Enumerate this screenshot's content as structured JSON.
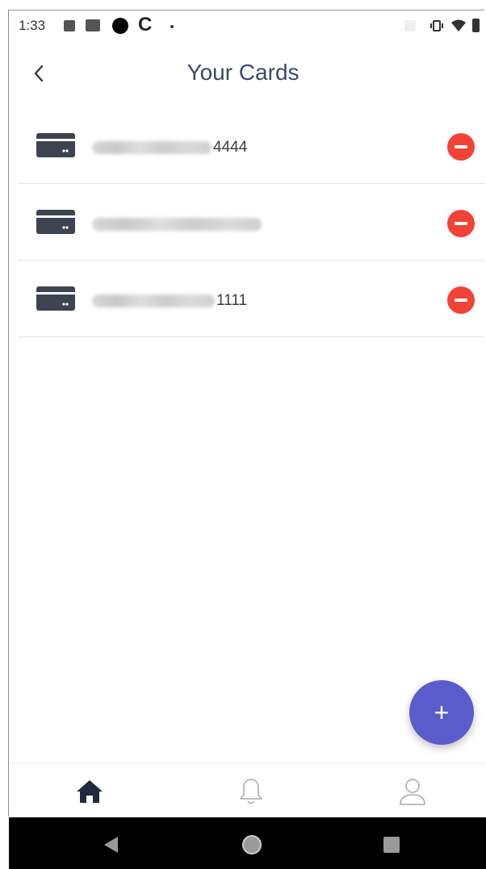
{
  "status_bar": {
    "time": "1:33",
    "icons": [
      "image-icon",
      "gallery-icon",
      "record-dot-icon",
      "c-app-icon",
      "dot-icon",
      "vibrate-icon",
      "wifi-icon",
      "battery-icon"
    ]
  },
  "header": {
    "title": "Your Cards",
    "back_icon": "chevron-left-icon"
  },
  "cards": [
    {
      "masked_prefix": "•••• •••• •••• ••",
      "suffix": "4444",
      "prefix_obscured": true
    },
    {
      "masked_prefix": "•••• •••• •••• ••••",
      "suffix": "",
      "prefix_obscured": true
    },
    {
      "masked_prefix": "•••• •••• •••• ••",
      "suffix": "1111",
      "prefix_obscured": true
    }
  ],
  "fab": {
    "label": "+"
  },
  "tab_bar": {
    "items": [
      {
        "name": "home",
        "icon": "home-icon",
        "active": true
      },
      {
        "name": "notifications",
        "icon": "bell-icon",
        "active": false
      },
      {
        "name": "profile",
        "icon": "user-icon",
        "active": false
      }
    ]
  },
  "colors": {
    "title": "#3c4a63",
    "remove": "#f24236",
    "fab": "#5a5ccc",
    "card_icon": "#3d4350",
    "active_tab": "#1f2a3c",
    "inactive_tab": "#b5b5b5"
  }
}
